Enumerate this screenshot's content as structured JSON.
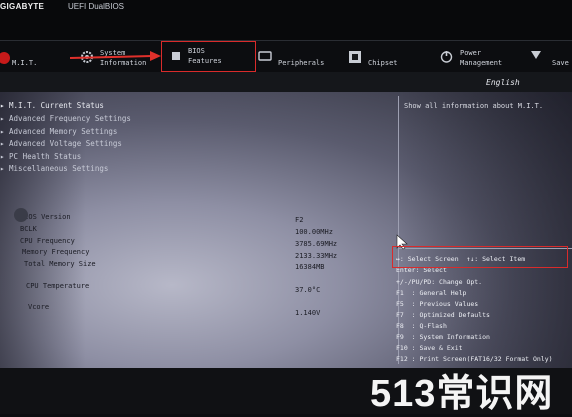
{
  "header": {
    "brand": "GIGABYTE",
    "product": "UEFI DualBIOS"
  },
  "tabs": [
    {
      "label": "M.I.T."
    },
    {
      "label": "System\nInformation"
    },
    {
      "label": "BIOS\nFeatures"
    },
    {
      "label": "Peripherals"
    },
    {
      "label": "Chipset"
    },
    {
      "label": "Power\nManagement"
    },
    {
      "label": "Save"
    }
  ],
  "language": "English",
  "menu": [
    {
      "label": "M.I.T. Current Status"
    },
    {
      "label": "Advanced Frequency Settings"
    },
    {
      "label": "Advanced Memory Settings"
    },
    {
      "label": "Advanced Voltage Settings"
    },
    {
      "label": "PC Health Status"
    },
    {
      "label": "Miscellaneous Settings"
    }
  ],
  "info": [
    {
      "label": "BIOS Version",
      "value": "F2"
    },
    {
      "label": "BCLK",
      "value": "100.00MHz"
    },
    {
      "label": "CPU Frequency",
      "value": "3785.69MHz"
    },
    {
      "label": "Memory Frequency",
      "value": "2133.33MHz"
    },
    {
      "label": "Total Memory Size",
      "value": "16384MB"
    },
    {
      "label": "CPU Temperature",
      "value": "37.0°C"
    },
    {
      "label": "Vcore",
      "value": "1.140V"
    }
  ],
  "help_text": "Show all information about M.I.T.",
  "keys": [
    "↔: Select Screen  ↑↓: Select Item",
    "Enter: Select",
    "+/-/PU/PD: Change Opt.",
    "F1  : General Help",
    "F5  : Previous Values",
    "F7  : Optimized Defaults",
    "F8  : Q-Flash",
    "F9  : System Information",
    "F10 : Save & Exit",
    "F12 : Print Screen(FAT16/32 Format Only)"
  ],
  "watermark": "513常识网",
  "colors": {
    "highlight_box": "#d92b2b",
    "arrow": "#e0302b"
  }
}
